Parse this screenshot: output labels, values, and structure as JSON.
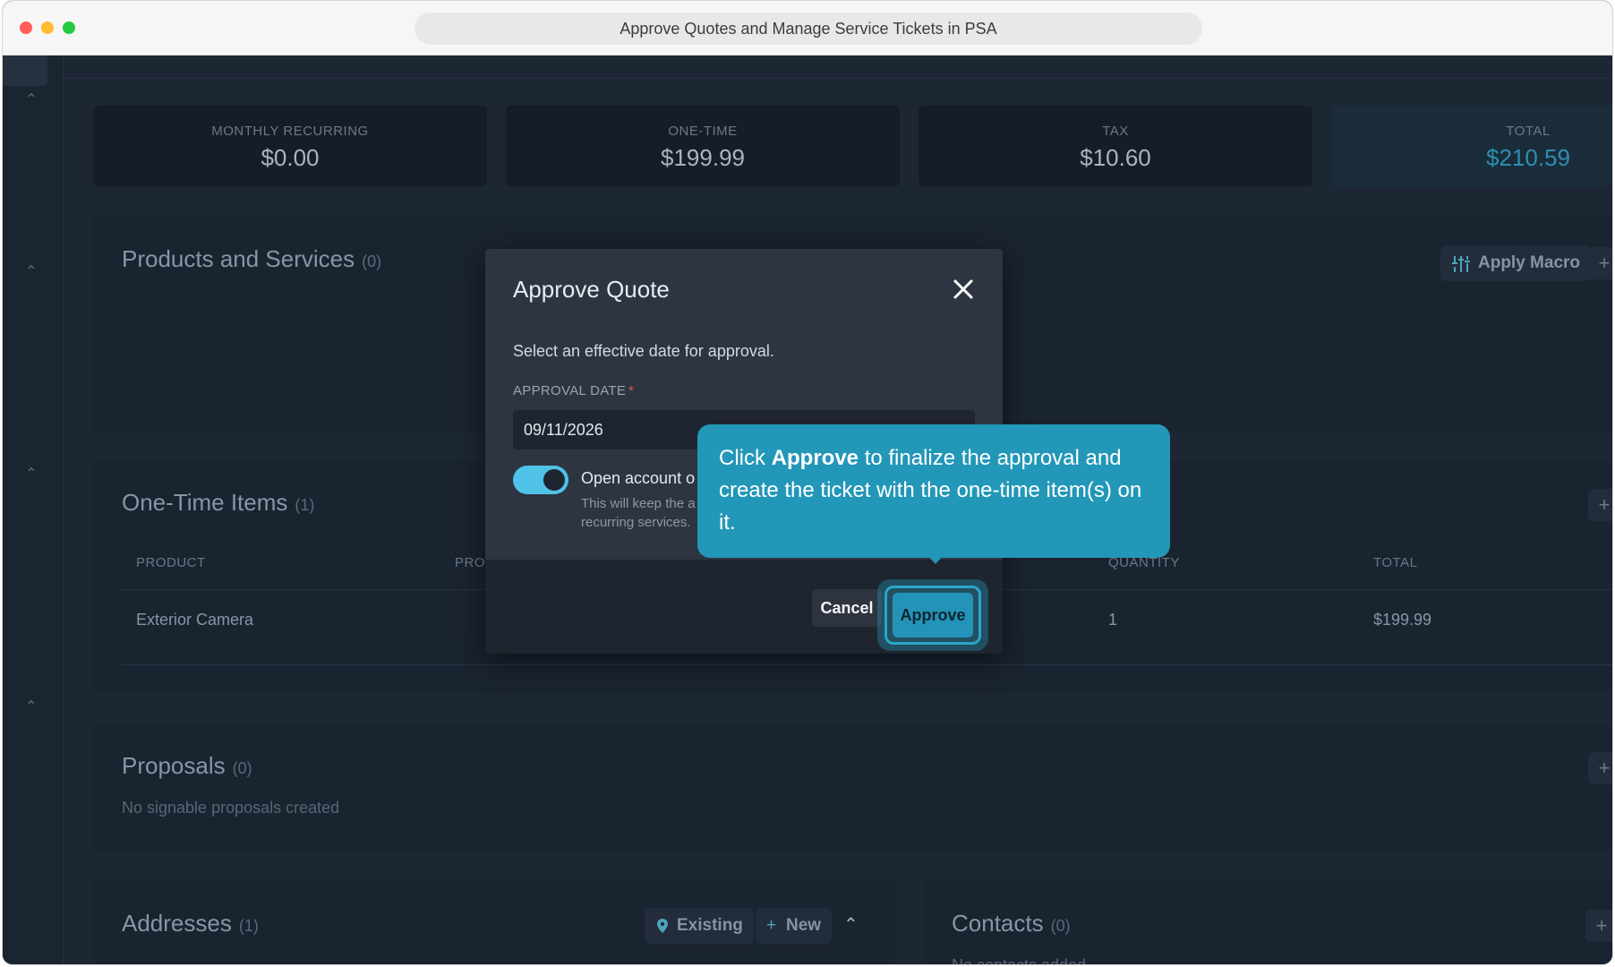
{
  "window": {
    "title": "Approve Quotes and Manage Service Tickets in PSA"
  },
  "stats": [
    {
      "label": "MONTHLY RECURRING",
      "value": "$0.00"
    },
    {
      "label": "ONE-TIME",
      "value": "$199.99"
    },
    {
      "label": "TAX",
      "value": "$10.60"
    },
    {
      "label": "TOTAL",
      "value": "$210.59"
    }
  ],
  "products": {
    "title": "Products and Services",
    "count": "(0)",
    "apply_macro": "Apply Macro"
  },
  "one_time": {
    "title": "One-Time Items",
    "count": "(1)",
    "headers": {
      "product": "PRODUCT",
      "prov": "PROV",
      "quantity": "QUANTITY",
      "total": "TOTAL"
    },
    "rows": [
      {
        "product": "Exterior Camera",
        "quantity": "1",
        "total": "$199.99"
      }
    ]
  },
  "proposals": {
    "title": "Proposals",
    "count": "(0)",
    "empty": "No signable proposals created"
  },
  "addresses": {
    "title": "Addresses",
    "count": "(1)",
    "existing": "Existing",
    "new": "New"
  },
  "contacts": {
    "title": "Contacts",
    "count": "(0)",
    "empty": "No contacts added"
  },
  "modal": {
    "title": "Approve Quote",
    "description": "Select an effective date for approval.",
    "date_label": "APPROVAL DATE",
    "required_mark": "*",
    "date_value": "09/11/2026",
    "toggle_label": "Open account o",
    "toggle_help": "This will keep the a recurring services.",
    "cancel": "Cancel",
    "approve": "Approve"
  },
  "tooltip": {
    "prefix": "Click ",
    "bold": "Approve",
    "suffix": " to finalize the approval and create the ticket with the one-time item(s) on it."
  },
  "colors": {
    "accent": "#2397b8",
    "toggle": "#4fc3e8",
    "total": "#2d8fb0"
  }
}
